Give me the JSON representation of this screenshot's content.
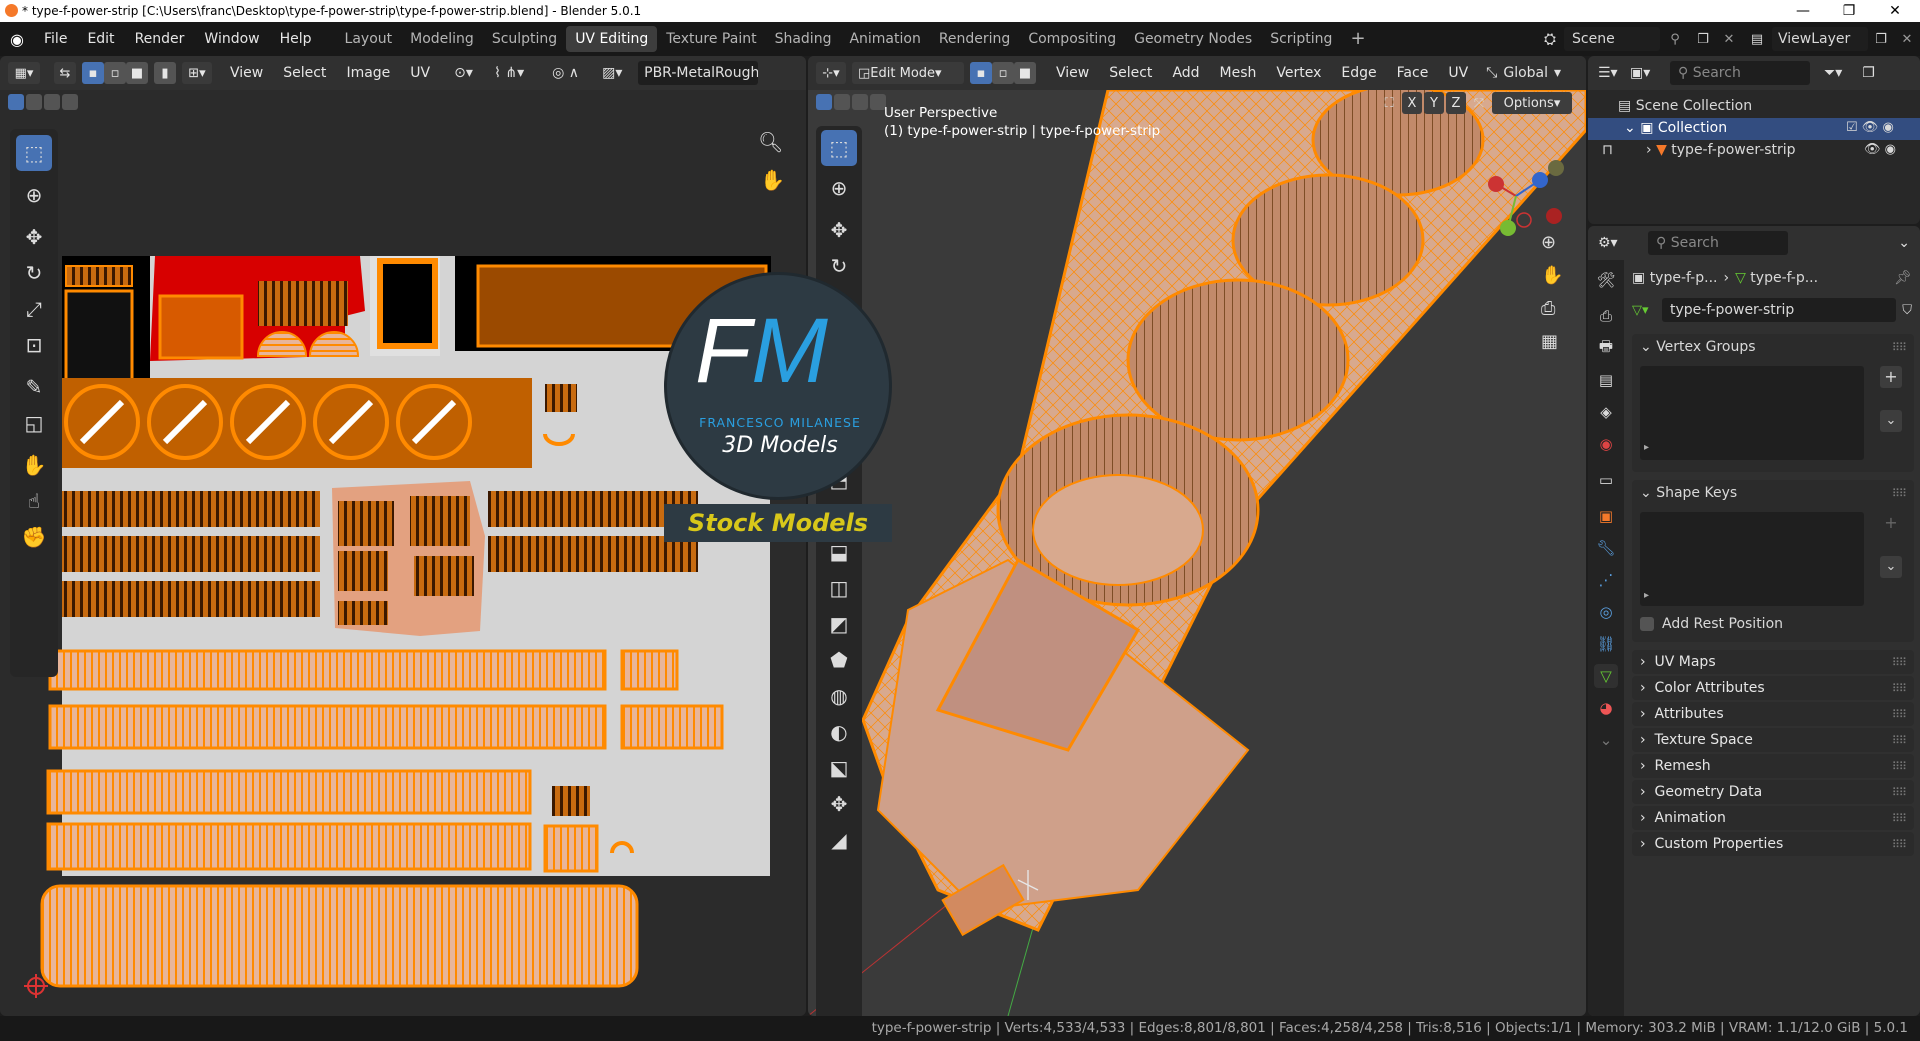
{
  "titlebar": {
    "text": "* type-f-power-strip [C:\\Users\\franc\\Desktop\\type-f-power-strip\\type-f-power-strip.blend] - Blender 5.0.1",
    "minimize": "—",
    "maximize": "❐",
    "close": "✕"
  },
  "menu": [
    "File",
    "Edit",
    "Render",
    "Window",
    "Help"
  ],
  "workspaces": [
    "Layout",
    "Modeling",
    "Sculpting",
    "UV Editing",
    "Texture Paint",
    "Shading",
    "Animation",
    "Rendering",
    "Compositing",
    "Geometry Nodes",
    "Scripting"
  ],
  "active_workspace": "UV Editing",
  "scene": {
    "label": "Scene",
    "viewlayer": "ViewLayer"
  },
  "uv_editor": {
    "menus": [
      "View",
      "Select",
      "Image",
      "UV"
    ],
    "image_name": "PBR-MetalRough"
  },
  "viewport": {
    "mode": "Edit Mode",
    "menus": [
      "View",
      "Select",
      "Add",
      "Mesh",
      "Vertex",
      "Edge",
      "Face",
      "UV"
    ],
    "orientation": "Global",
    "options": "Options",
    "view_name": "User Perspective",
    "object_info": "(1) type-f-power-strip | type-f-power-strip",
    "axes": {
      "x": "X",
      "y": "Y",
      "z": "Z"
    }
  },
  "watermark": {
    "initials_f": "F",
    "initials_m": "M",
    "studio": "FRANCESCO MILANESE",
    "sub": "3D Models",
    "banner": "Stock Models"
  },
  "outliner": {
    "search_placeholder": "Search",
    "scene_collection": "Scene Collection",
    "collection": "Collection",
    "object": "type-f-power-strip"
  },
  "properties": {
    "search_placeholder": "Search",
    "breadcrumb_a": "type-f-p...",
    "breadcrumb_b": "type-f-p...",
    "mesh_name": "type-f-power-strip",
    "sections_open": [
      "Vertex Groups",
      "Shape Keys"
    ],
    "add_rest_position": "Add Rest Position",
    "sections": [
      "UV Maps",
      "Color Attributes",
      "Attributes",
      "Texture Space",
      "Remesh",
      "Geometry Data",
      "Animation",
      "Custom Properties"
    ]
  },
  "statusbar": "type-f-power-strip | Verts:4,533/4,533 | Edges:8,801/8,801 | Faces:4,258/4,258 | Tris:8,516 | Objects:1/1 | Memory: 303.2 MiB | VRAM: 1.1/12.0 GiB | 5.0.1",
  "colors": {
    "accent": "#4772b3",
    "orange": "#ff8a00",
    "uv_bg": "#d4d4d4"
  }
}
